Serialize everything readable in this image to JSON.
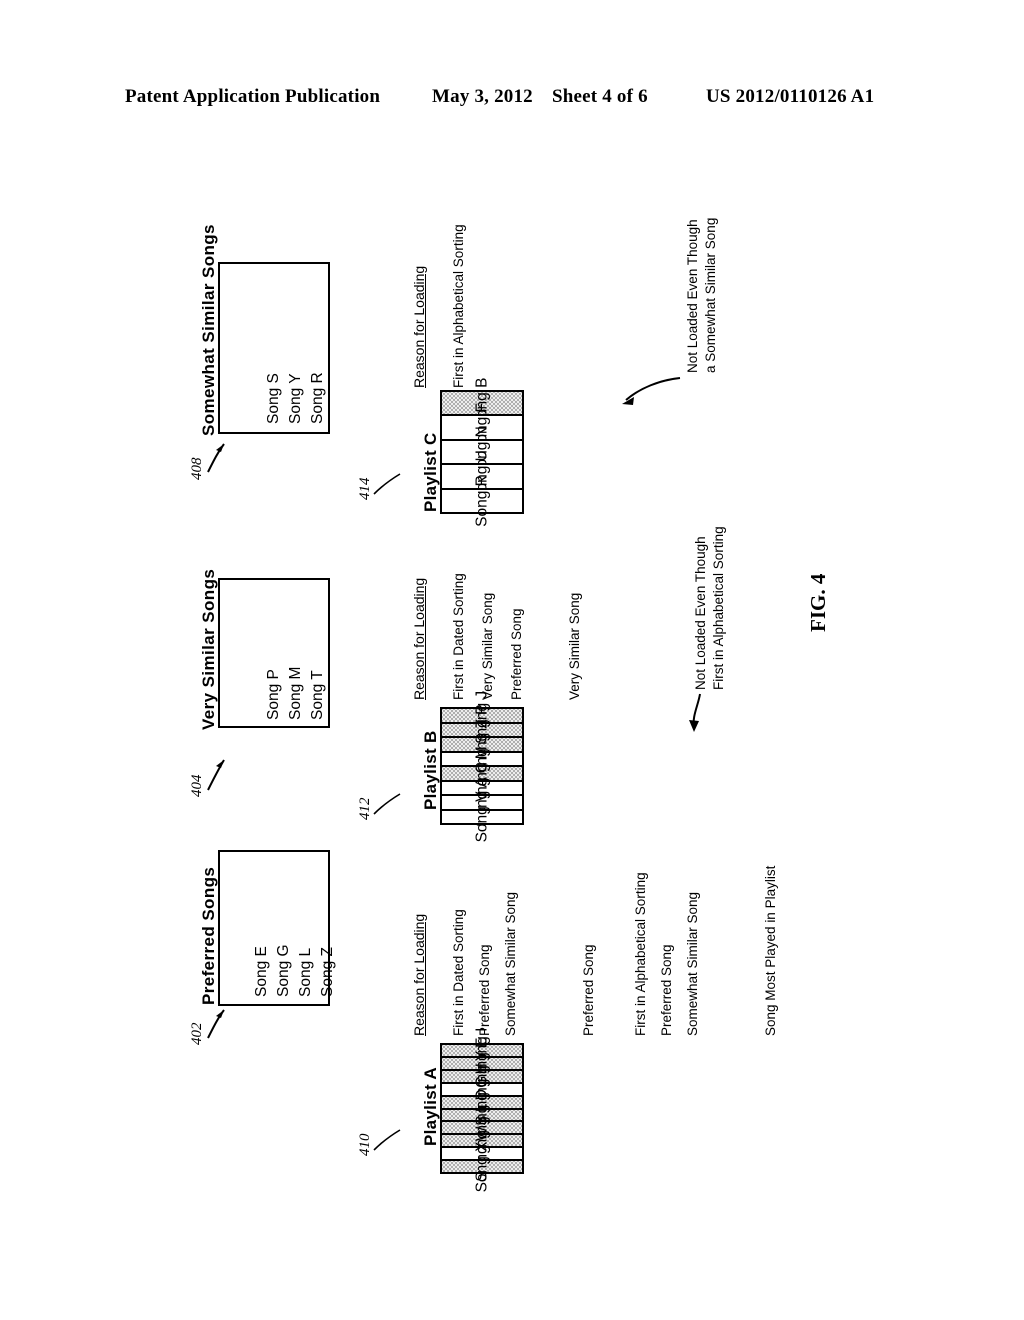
{
  "header": {
    "title": "Patent Application Publication",
    "date": "May 3, 2012",
    "sheet": "Sheet 4 of 6",
    "number": "US 2012/0110126 A1"
  },
  "figure": {
    "caption": "FIG. 4"
  },
  "source_boxes": [
    {
      "id": "preferred",
      "title": "Preferred Songs",
      "ref": "402",
      "songs": [
        "Song E",
        "Song G",
        "Song L",
        "Song Z"
      ]
    },
    {
      "id": "very-similar",
      "title": "Very Similar Songs",
      "ref": "404",
      "songs": [
        "Song P",
        "Song M",
        "Song T"
      ]
    },
    {
      "id": "somewhat-similar",
      "title": "Somewhat Similar Songs",
      "ref": "408",
      "songs": [
        "Song S",
        "Song Y",
        "Song R"
      ]
    }
  ],
  "reason_heading": "Reason for Loading",
  "playlists": [
    {
      "id": "playlist-a",
      "title": "Playlist A",
      "ref": "410",
      "items": [
        {
          "song": "Song I",
          "shaded": true,
          "reason": "First in Dated Sorting"
        },
        {
          "song": "Song E",
          "shaded": true,
          "reason": "Preferred Song"
        },
        {
          "song": "Song Y",
          "shaded": true,
          "reason": "Somewhat Similar Song"
        },
        {
          "song": "Song H",
          "shaded": false,
          "reason": ""
        },
        {
          "song": "Song G",
          "shaded": true,
          "reason": "Preferred Song"
        },
        {
          "song": "Song D",
          "shaded": true,
          "reason": "First in Alphabetical Sorting"
        },
        {
          "song": "Song L",
          "shaded": true,
          "reason": "Preferred Song"
        },
        {
          "song": "Song S",
          "shaded": true,
          "reason": "Somewhat Similar Song"
        },
        {
          "song": "Song W",
          "shaded": false,
          "reason": ""
        },
        {
          "song": "Song X",
          "shaded": true,
          "reason": "Song Most Played in Playlist"
        }
      ],
      "annotation": null
    },
    {
      "id": "playlist-b",
      "title": "Playlist B",
      "ref": "412",
      "items": [
        {
          "song": "Song J",
          "shaded": true,
          "reason": "First in Dated Sorting"
        },
        {
          "song": "Song P",
          "shaded": true,
          "reason": "Very Similar Song"
        },
        {
          "song": "Song Z",
          "shaded": true,
          "reason": "Preferred Song"
        },
        {
          "song": "Song S",
          "shaded": false,
          "reason": ""
        },
        {
          "song": "Song M",
          "shaded": true,
          "reason": "Very Similar Song"
        },
        {
          "song": "Song C",
          "shaded": false,
          "reason": ""
        },
        {
          "song": "Song A",
          "shaded": false,
          "reason": ""
        },
        {
          "song": "Song V",
          "shaded": false,
          "reason": ""
        }
      ],
      "annotation": {
        "line1": "Not Loaded Even Though",
        "line2": "First in Alphabetical Sorting"
      }
    },
    {
      "id": "playlist-c",
      "title": "Playlist C",
      "ref": "414",
      "items": [
        {
          "song": "Song B",
          "shaded": true,
          "reason": "First in Alphabetical Sorting"
        },
        {
          "song": "Song F",
          "shaded": false,
          "reason": ""
        },
        {
          "song": "Song N",
          "shaded": false,
          "reason": ""
        },
        {
          "song": "Song U",
          "shaded": false,
          "reason": ""
        },
        {
          "song": "Song R",
          "shaded": false,
          "reason": ""
        }
      ],
      "annotation": {
        "line1": "Not Loaded Even Though",
        "line2": "a Somewhat Similar Song"
      }
    }
  ]
}
